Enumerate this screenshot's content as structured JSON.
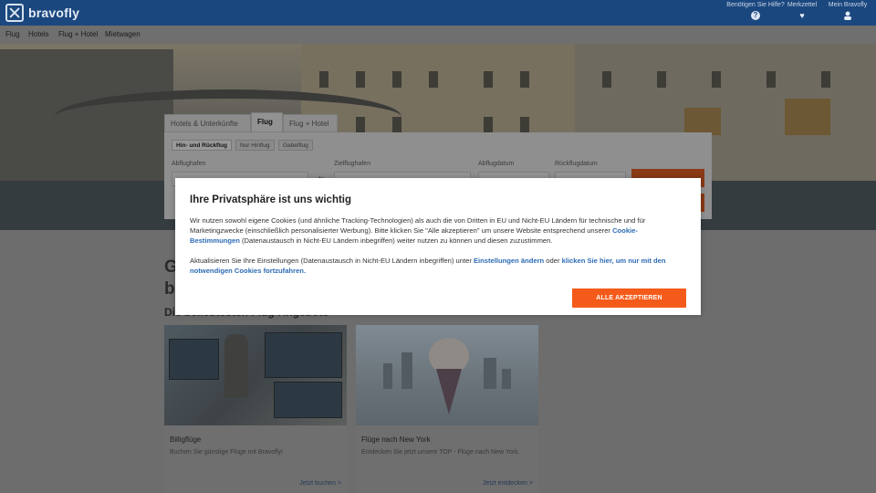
{
  "header": {
    "logo_text": "bravofly",
    "help_label": "Benötigen Sie Hilfe?",
    "help_icon": "?",
    "wishlist_label": "Merkzettel",
    "account_label": "Mein Bravofly"
  },
  "nav": {
    "items": [
      "Flug",
      "Hotels",
      "Flug + Hotel",
      "Mietwagen"
    ]
  },
  "search": {
    "tabs": [
      "Hotels & Unterkünfte",
      "Flug",
      "Flug + Hotel"
    ],
    "active_tab": "Flug",
    "trip_types": [
      "Hin- und Rückflug",
      "Nur Hinflug",
      "Gabelflug"
    ],
    "active_trip_type": "Hin- und Rückflug",
    "from_label": "Abflughafen",
    "to_label": "Zielflughafen",
    "depart_label": "Abflugdatum",
    "return_label": "Rückflugdatum"
  },
  "content": {
    "heading_line1": "G",
    "heading_line2": "b",
    "section_title": "Die beliebtesten Flug-Angebote",
    "cards": [
      {
        "title": "Billigflüge",
        "description": "Buchen Sie günstige Flüge mit Bravofly!",
        "link": "Jetzt buchen >"
      },
      {
        "title": "Flüge nach New York",
        "description": "Entdecken Sie jetzt unsere TOP - Flüge nach New York.",
        "link": "Jetzt entdecken >"
      }
    ]
  },
  "cookie_modal": {
    "title": "Ihre Privatsphäre ist uns wichtig",
    "p1_text_a": "Wir nutzen sowohl eigene Cookies (und ähnliche Tracking-Technologien) als auch die von Dritten in EU und Nicht-EU Ländern für technische und für Marketingzwecke (einschließlich personalisierter Werbung). Bitte klicken Sie \"Alle akzeptieren\" um unsere Website entsprechend unserer ",
    "p1_link": "Cookie-Bestimmungen",
    "p1_text_b": " (Datenaustausch in Nicht-EU Ländern inbegriffen) weiter nutzen zu können und diesen zuzustimmen.",
    "p2_text_a": "Aktualisieren Sie Ihre Einstellungen (Datenaustausch in Nicht-EU Ländern inbegriffen) unter ",
    "p2_link1": "Einstellungen ändern",
    "p2_text_b": " oder ",
    "p2_link2": "klicken Sie hier, um nur mit den notwendigen Cookies fortzufahren.",
    "accept_button": "ALLE AKZEPTIEREN"
  },
  "colors": {
    "header_bg": "#1b477f",
    "accent": "#f45a1a",
    "link": "#2c6bb5"
  }
}
